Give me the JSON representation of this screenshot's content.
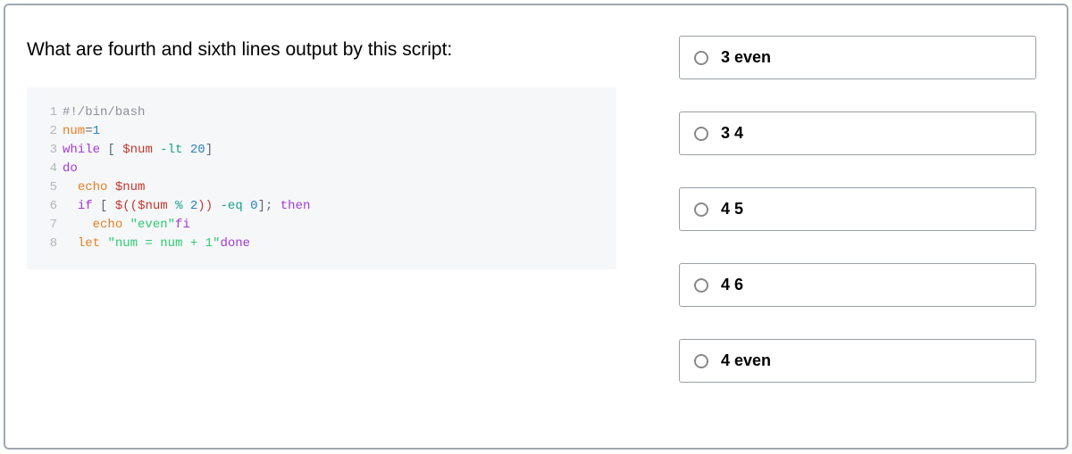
{
  "question": "What are fourth and sixth lines output by this script:",
  "code_lines": [
    {
      "n": "1",
      "segments": [
        {
          "cls": "c-comment",
          "text": "#!/bin/bash"
        }
      ]
    },
    {
      "n": "2",
      "segments": [
        {
          "cls": "c-builtin",
          "text": "num"
        },
        {
          "cls": "c-text",
          "text": "="
        },
        {
          "cls": "c-num",
          "text": "1"
        }
      ]
    },
    {
      "n": "3",
      "segments": [
        {
          "cls": "c-keyword",
          "text": "while"
        },
        {
          "cls": "c-text",
          "text": " [ "
        },
        {
          "cls": "c-var",
          "text": "$num"
        },
        {
          "cls": "c-text",
          "text": " "
        },
        {
          "cls": "c-op",
          "text": "-lt"
        },
        {
          "cls": "c-text",
          "text": " "
        },
        {
          "cls": "c-num",
          "text": "20"
        },
        {
          "cls": "c-text",
          "text": "]"
        }
      ]
    },
    {
      "n": "4",
      "segments": [
        {
          "cls": "c-keyword",
          "text": "do"
        }
      ]
    },
    {
      "n": "5",
      "segments": [
        {
          "cls": "c-text",
          "text": "  "
        },
        {
          "cls": "c-builtin",
          "text": "echo"
        },
        {
          "cls": "c-text",
          "text": " "
        },
        {
          "cls": "c-var",
          "text": "$num"
        }
      ]
    },
    {
      "n": "6",
      "segments": [
        {
          "cls": "c-text",
          "text": "  "
        },
        {
          "cls": "c-keyword",
          "text": "if"
        },
        {
          "cls": "c-text",
          "text": " [ "
        },
        {
          "cls": "c-var",
          "text": "$(("
        },
        {
          "cls": "c-var",
          "text": "$num"
        },
        {
          "cls": "c-text",
          "text": " "
        },
        {
          "cls": "c-op",
          "text": "%"
        },
        {
          "cls": "c-text",
          "text": " "
        },
        {
          "cls": "c-num",
          "text": "2"
        },
        {
          "cls": "c-var",
          "text": "))"
        },
        {
          "cls": "c-text",
          "text": " "
        },
        {
          "cls": "c-op",
          "text": "-eq"
        },
        {
          "cls": "c-text",
          "text": " "
        },
        {
          "cls": "c-num",
          "text": "0"
        },
        {
          "cls": "c-text",
          "text": "]; "
        },
        {
          "cls": "c-keyword",
          "text": "then"
        }
      ]
    },
    {
      "n": "7",
      "segments": [
        {
          "cls": "c-text",
          "text": "    "
        },
        {
          "cls": "c-builtin",
          "text": "echo"
        },
        {
          "cls": "c-text",
          "text": " "
        },
        {
          "cls": "c-string",
          "text": "\"even\""
        },
        {
          "cls": "c-keyword",
          "text": "fi"
        }
      ]
    },
    {
      "n": "8",
      "segments": [
        {
          "cls": "c-text",
          "text": "  "
        },
        {
          "cls": "c-builtin",
          "text": "let"
        },
        {
          "cls": "c-text",
          "text": " "
        },
        {
          "cls": "c-string",
          "text": "\"num = num + 1\""
        },
        {
          "cls": "c-keyword",
          "text": "done"
        }
      ]
    }
  ],
  "options": [
    {
      "id": "opt-1",
      "label": "3 even"
    },
    {
      "id": "opt-2",
      "label": "3 4"
    },
    {
      "id": "opt-3",
      "label": "4 5"
    },
    {
      "id": "opt-4",
      "label": "4 6"
    },
    {
      "id": "opt-5",
      "label": "4 even"
    }
  ]
}
